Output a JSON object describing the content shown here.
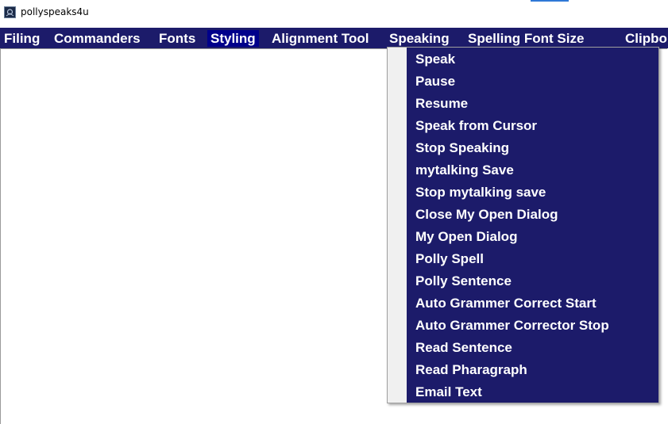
{
  "window": {
    "title": "pollyspeaks4u",
    "icon": "app-icon"
  },
  "menubar": {
    "items": [
      {
        "label": "Filing",
        "selected": false
      },
      {
        "label": "Commanders",
        "selected": false
      },
      {
        "label": "Fonts",
        "selected": false
      },
      {
        "label": "Styling",
        "selected": true
      },
      {
        "label": "Alignment Tool",
        "selected": false
      },
      {
        "label": "Speaking",
        "selected": false
      },
      {
        "label": "Spelling Font Size",
        "selected": false
      },
      {
        "label": "Clipbo",
        "selected": false
      }
    ]
  },
  "speaking_menu": {
    "items": [
      "Speak",
      "Pause",
      "Resume",
      "Speak from Cursor",
      "Stop Speaking",
      "mytalking Save",
      "Stop mytalking save",
      "Close My Open Dialog",
      "My Open Dialog",
      "Polly Spell",
      "Polly Sentence",
      "Auto Grammer Correct Start",
      "Auto Grammer Corrector Stop",
      "Read Sentence",
      "Read Pharagraph",
      "Email Text"
    ]
  },
  "colors": {
    "menu_background": "#1c1b6a",
    "menu_selected": "#00008b",
    "menu_text": "#ffffff",
    "dropdown_gutter": "#f0f0f0"
  }
}
